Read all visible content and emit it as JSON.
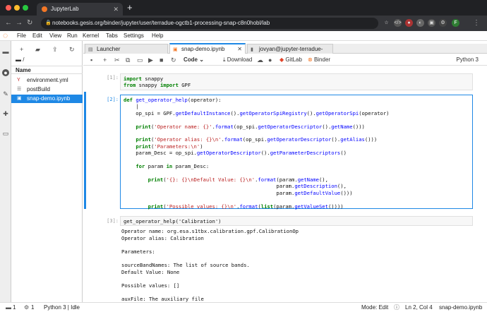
{
  "browser": {
    "tab_title": "JupyterLab",
    "url": "notebooks.gesis.org/binder/jupyter/user/terradue-ogctb1-processing-snap-c8n0hobl/lab",
    "profile_initial": "F"
  },
  "menubar": {
    "items": [
      "File",
      "Edit",
      "View",
      "Run",
      "Kernel",
      "Tabs",
      "Settings",
      "Help"
    ]
  },
  "filebrowser": {
    "path": "/",
    "header": "Name",
    "files": [
      "environment.yml",
      "postBuild",
      "snap-demo.ipynb"
    ],
    "file_icons": [
      "Y",
      "☰",
      "▣"
    ]
  },
  "tabs": [
    "Launcher",
    "snap-demo.ipynb",
    "jovyan@jupyter-terradue-"
  ],
  "toolbar": {
    "cell_type": "Code",
    "download": "Download",
    "gitlab": "GitLab",
    "binder": "Binder",
    "kernel": "Python 3"
  },
  "cells": [
    {
      "prompt": "[1]:"
    },
    {
      "prompt": "[2]:"
    },
    {
      "prompt": "[3]:",
      "source": "get_operator_help('Calibration')"
    }
  ],
  "output_lines": [
    "Operator name: org.esa.s1tbx.calibration.gpf.CalibrationOp",
    "Operator alias: Calibration",
    "",
    "Parameters:",
    "",
    "sourceBandNames: The list of source bands.",
    "Default Value: None",
    "",
    "Possible values: []",
    "",
    "auxFile: The auxiliary file"
  ],
  "status": {
    "left_num1": "1",
    "left_num2": "1",
    "kernel": "Python 3 | Idle",
    "mode": "Mode: Edit",
    "position": "Ln 2, Col 4",
    "filename": "snap-demo.ipynb"
  }
}
